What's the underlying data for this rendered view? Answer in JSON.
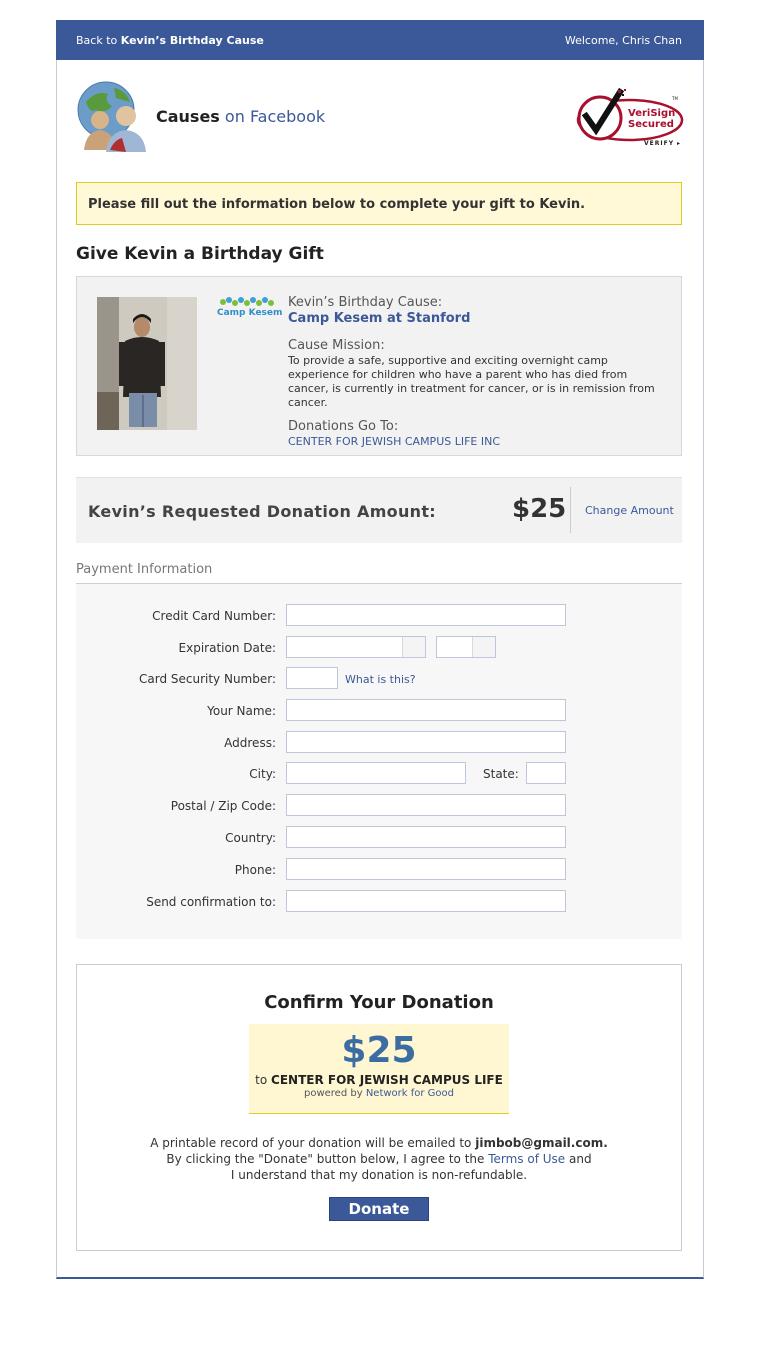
{
  "header": {
    "back_prefix": "Back to",
    "back_target": "Kevin’s Birthday Cause",
    "welcome": "Welcome, Chris Chan"
  },
  "brand": {
    "causes": "Causes",
    "on_facebook": "on Facebook"
  },
  "verisign": {
    "line1": "VeriSign",
    "line2": "Secured",
    "verify": "VERIFY",
    "tm": "TM"
  },
  "notice": "Please fill out the information below to complete your gift to Kevin.",
  "gift_heading": "Give Kevin a Birthday Gift",
  "cause": {
    "logo_text": "Camp Kesem",
    "label": "Kevin’s Birthday Cause:",
    "name": "Camp Kesem at Stanford",
    "mission_label": "Cause Mission:",
    "mission": "To provide a safe, supportive and exciting overnight camp experience for children who have a parent who has died from cancer, is currently in treatment for cancer, or is in remission from cancer.",
    "donations_label": "Donations Go To:",
    "donations_org": "CENTER FOR JEWISH CAMPUS LIFE INC"
  },
  "requested": {
    "label": "Kevin’s Requested Donation Amount:",
    "amount": "$25",
    "change": "Change Amount"
  },
  "payment": {
    "title": "Payment Information",
    "card_number": "Credit Card Number:",
    "expiration": "Expiration Date:",
    "security": "Card Security Number:",
    "what_is_this": "What is this?",
    "name": "Your Name:",
    "address": "Address:",
    "city": "City:",
    "state": "State:",
    "postal": "Postal / Zip Code:",
    "country": "Country:",
    "phone": "Phone:",
    "confirm_to": "Send confirmation to:"
  },
  "confirm": {
    "title": "Confirm Your Donation",
    "amount": "$25",
    "to_prefix": "to",
    "to_org": "CENTER FOR JEWISH CAMPUS LIFE",
    "powered_prefix": "powered by",
    "powered_org": "Network for Good",
    "line1_prefix": "A printable record of your donation will be emailed to",
    "email": "jimbob@gmail.com.",
    "line2_prefix": "By clicking the \"Donate\" button below, I agree to the",
    "terms": "Terms of Use",
    "line2_suffix": "and",
    "line3": "I understand that my donation is non-refundable.",
    "donate": "Donate"
  },
  "colors": {
    "facebook_blue": "#3b5998",
    "notice_bg": "#fff9d7",
    "notice_border": "#e2c822",
    "verisign_red": "#a8102d"
  }
}
